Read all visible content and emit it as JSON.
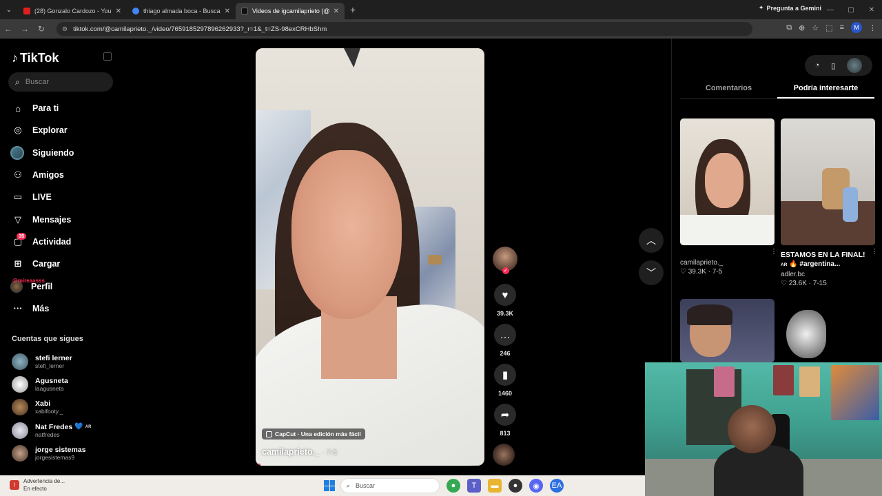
{
  "browser": {
    "tabs": [
      {
        "label": "(28) Gonzalo Cardozo - YouTub",
        "color": "#e02020"
      },
      {
        "label": "thiago almada boca - Buscar co",
        "color": "#4285f4"
      },
      {
        "label": "Videos de igcamilaprieto (@ca",
        "color": "#111111"
      }
    ],
    "new_tab": "+",
    "gemini": "Pregunta a Gemini",
    "url": "tiktok.com/@camilaprieto._/video/7659185297896262933?_r=1&_t=ZS-98exCRHbShm",
    "profile_initial": "M"
  },
  "sidebar": {
    "logo": "TikTok",
    "search_placeholder": "Buscar",
    "nav": [
      {
        "label": "Para ti",
        "icon": "home-icon",
        "glyph": "⌂"
      },
      {
        "label": "Explorar",
        "icon": "compass-icon",
        "glyph": "◎"
      },
      {
        "label": "Siguiendo",
        "icon": "following-avatar",
        "glyph": ""
      },
      {
        "label": "Amigos",
        "icon": "friends-icon",
        "glyph": "👥"
      },
      {
        "label": "LIVE",
        "icon": "live-icon",
        "glyph": "▭"
      },
      {
        "label": "Mensajes",
        "icon": "messages-icon",
        "glyph": "▽"
      },
      {
        "label": "Actividad",
        "icon": "activity-icon",
        "glyph": "▢",
        "badge": "35"
      },
      {
        "label": "Cargar",
        "icon": "upload-icon",
        "glyph": "⊞"
      },
      {
        "label": "Perfil",
        "icon": "profile-icon",
        "glyph": "",
        "overlay": "@mireaasss"
      },
      {
        "label": "Más",
        "icon": "more-icon",
        "glyph": "···"
      }
    ],
    "following_title": "Cuentas que sigues",
    "following": [
      {
        "name": "stefi lerner",
        "handle": "stefi_lerner",
        "color": "#6a8a9a"
      },
      {
        "name": "Agusneta",
        "handle": "laagusneta",
        "color": "#e6e6e6"
      },
      {
        "name": "Xabi",
        "handle": "xabifooty._",
        "color": "#7a5a3a"
      },
      {
        "name": "Nat Fredes",
        "handle": "natfredes",
        "color": "#c9c9d4",
        "heart": "💙",
        "ar": "AR"
      },
      {
        "name": "jorge sistemas",
        "handle": "jorgesistemas9",
        "color": "#8a6e5a"
      }
    ]
  },
  "video": {
    "capcut": "CapCut · Una edición más fácil",
    "author": "camilaprieto._",
    "date": "· 7-5",
    "progress": 0.02
  },
  "actions": {
    "likes": "39.3K",
    "comments": "246",
    "saves": "1460",
    "shares": "813"
  },
  "right_panel": {
    "tabs": [
      "Comentarios",
      "Podría interesarte"
    ],
    "active_tab": 1,
    "cards": [
      {
        "user": "camilaprieto._",
        "likes": "39.3K",
        "date": "7-5"
      },
      {
        "title": "ESTAMOS EN LA FINAL!",
        "subtitle": "#argentina...",
        "ar": "AR",
        "user": "adler.bc",
        "likes": "23.6K",
        "date": "7-15"
      }
    ]
  },
  "taskbar": {
    "warning_title": "Advertencia de...",
    "warning_sub": "En efecto",
    "search": "Buscar"
  },
  "colors": {
    "accent": "#fe2c55",
    "background": "#000000"
  }
}
